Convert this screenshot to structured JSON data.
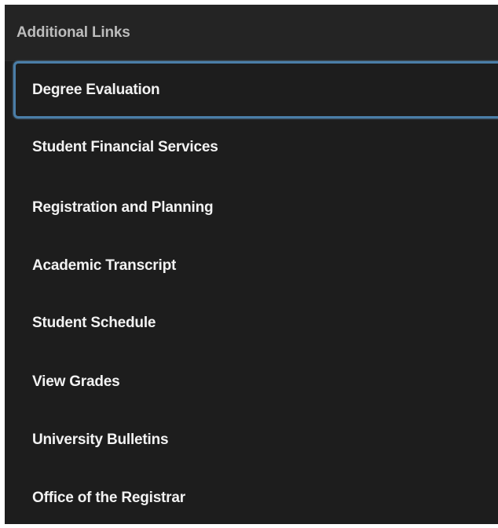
{
  "panel": {
    "title": "Additional Links",
    "items": [
      {
        "label": "Degree Evaluation",
        "focused": true
      },
      {
        "label": "Student Financial Services",
        "focused": false
      },
      {
        "label": "Registration and Planning",
        "focused": false
      },
      {
        "label": "Academic Transcript",
        "focused": false
      },
      {
        "label": "Student Schedule",
        "focused": false
      },
      {
        "label": "View Grades",
        "focused": false
      },
      {
        "label": "University Bulletins",
        "focused": false
      },
      {
        "label": "Office of the Registrar",
        "focused": false
      }
    ]
  },
  "colors": {
    "panel_bg": "#1d1d1d",
    "header_text": "#bcbcbc",
    "link_text": "#f2f2f2",
    "focus_ring": "#4a7ea8"
  }
}
